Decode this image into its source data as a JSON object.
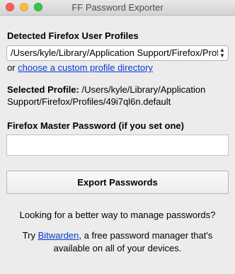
{
  "window": {
    "title": "FF Password Exporter"
  },
  "profiles": {
    "heading": "Detected Firefox User Profiles",
    "selected_option": "/Users/kyle/Library/Application Support/Firefox/Profiles/49i7ql6n.default",
    "or_text": "or ",
    "custom_link": "choose a custom profile directory"
  },
  "selected_profile": {
    "label": "Selected Profile:",
    "path": " /Users/kyle/Library/Application Support/Firefox/Profiles/49i7ql6n.default"
  },
  "master_password": {
    "label": "Firefox Master Password (if you set one)",
    "value": "",
    "placeholder": ""
  },
  "export": {
    "button_label": "Export Passwords"
  },
  "promo": {
    "question": "Looking for a better way to manage passwords?",
    "try_text": "Try ",
    "bitwarden_link": "Bitwarden",
    "after_link": ", a free password manager that's",
    "second_line": "available on all of your devices."
  }
}
